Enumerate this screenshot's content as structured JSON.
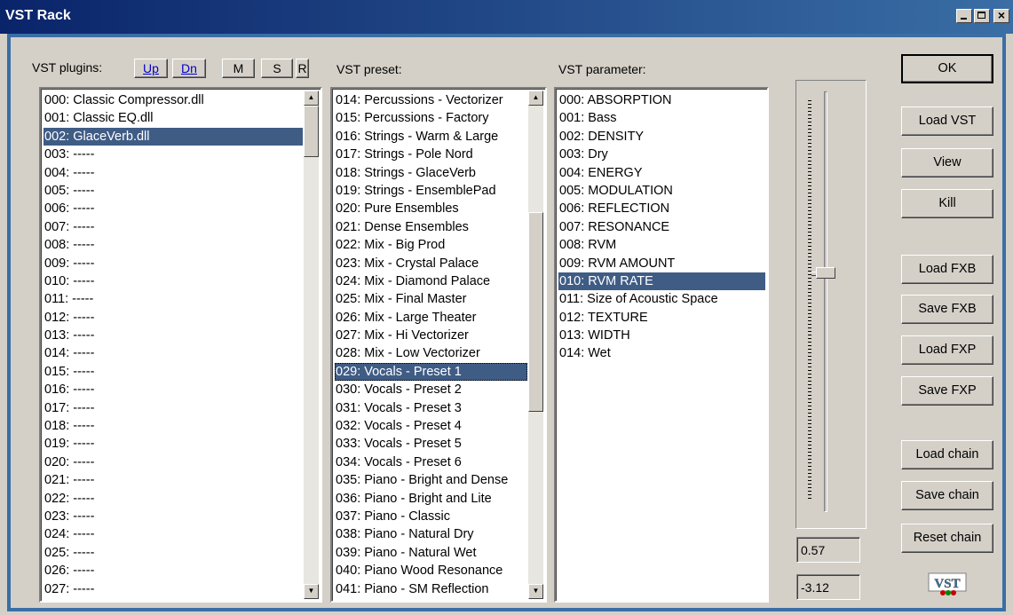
{
  "window": {
    "title": "VST Rack"
  },
  "plugins": {
    "label": "VST plugins:",
    "buttons": {
      "up": "Up",
      "dn": "Dn",
      "m": "M",
      "s": "S",
      "r": "R"
    },
    "items": [
      "000: Classic Compressor.dll",
      "001: Classic EQ.dll",
      "002: GlaceVerb.dll",
      "003: -----",
      "004: -----",
      "005: -----",
      "006: -----",
      "007: -----",
      "008: -----",
      "009: -----",
      "010: -----",
      "011: -----",
      "012: -----",
      "013: -----",
      "014: -----",
      "015: -----",
      "016: -----",
      "017: -----",
      "018: -----",
      "019: -----",
      "020: -----",
      "021: -----",
      "022: -----",
      "023: -----",
      "024: -----",
      "025: -----",
      "026: -----",
      "027: -----"
    ],
    "selected": 2
  },
  "presets": {
    "label": "VST preset:",
    "items": [
      "014: Percussions - Vectorizer",
      "015: Percussions - Factory",
      "016: Strings  - Warm & Large",
      "017: Strings - Pole Nord",
      "018: Strings - GlaceVerb",
      "019: Strings - EnsemblePad",
      "020: Pure Ensembles",
      "021: Dense Ensembles",
      "022: Mix - Big Prod",
      "023: Mix - Crystal Palace",
      "024: Mix - Diamond Palace",
      "025: Mix - Final Master",
      "026: Mix - Large Theater",
      "027: Mix - Hi Vectorizer",
      "028: Mix - Low Vectorizer",
      "029: Vocals - Preset 1",
      "030: Vocals - Preset 2",
      "031: Vocals - Preset 3",
      "032: Vocals - Preset 4",
      "033: Vocals - Preset 5",
      "034: Vocals - Preset 6",
      "035: Piano - Bright and Dense",
      "036: Piano - Bright and Lite",
      "037: Piano - Classic",
      "038: Piano - Natural Dry",
      "039: Piano - Natural Wet",
      "040: Piano Wood Resonance",
      "041: Piano - SM Reflection"
    ],
    "selected": 15
  },
  "parameters": {
    "label": "VST parameter:",
    "items": [
      "000: ABSORPTION",
      "001: Bass",
      "002: DENSITY",
      "003: Dry",
      "004: ENERGY",
      "005: MODULATION",
      "006: REFLECTION",
      "007: RESONANCE",
      "008: RVM",
      "009: RVM AMOUNT",
      "010: RVM RATE",
      "011: Size of Acoustic Space",
      "012: TEXTURE",
      "013: WIDTH",
      "014: Wet"
    ],
    "selected": 10
  },
  "slider": {
    "value": "0.57",
    "value_fraction": 0.43,
    "secondary_value": "-3.12"
  },
  "buttons": {
    "ok": "OK",
    "load_vst": "Load VST",
    "view": "View",
    "kill": "Kill",
    "load_fxb": "Load FXB",
    "save_fxb": "Save FXB",
    "load_fxp": "Load FXP",
    "save_fxp": "Save FXP",
    "load_chain": "Load chain",
    "save_chain": "Save chain",
    "reset_chain": "Reset chain"
  },
  "logo_text": "VST"
}
